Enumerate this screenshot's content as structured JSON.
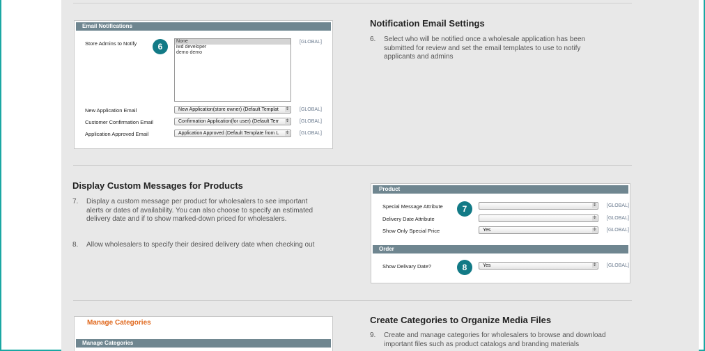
{
  "email_panel": {
    "header": "Email Notifications",
    "store_admins_label": "Store Admins to Notify",
    "admins_options": [
      "None",
      "iwd developer",
      "demo demo"
    ],
    "new_app_label": "New Application Email",
    "new_app_value": "New Application(store owner) (Default Templat",
    "customer_conf_label": "Customer Confirmation Email",
    "customer_conf_value": "Confirmation Application(for user) (Default Terr",
    "approved_label": "Application Approved Email",
    "approved_value": "Application Approved (Default Template from L",
    "scope": "[GLOBAL]",
    "badge": "6"
  },
  "notification_section": {
    "heading": "Notification Email Settings",
    "step_num": "6.",
    "step_text": "Select who will be notified once a wholesale application has been submitted for review and set the email templates to use to notify applicants and admins"
  },
  "custom_messages_section": {
    "heading": "Display Custom Messages for Products",
    "step7_num": "7.",
    "step7_text": "Display a custom message per product for wholesalers to see important alerts or dates of availability. You can also choose to specify an estimated delivery date and if to show marked-down priced for wholesalers.",
    "step8_num": "8.",
    "step8_text": "Allow wholesalers to specify their desired delivery date when checking out"
  },
  "product_panel": {
    "header": "Product",
    "special_msg_label": "Special Message Attribute",
    "special_msg_value": "",
    "delivery_date_label": "Delivery Date Attribute",
    "delivery_date_value": "",
    "special_price_label": "Show Only Special Price",
    "special_price_value": "Yes",
    "scope": "[GLOBAL]",
    "badge": "7"
  },
  "order_panel": {
    "header": "Order",
    "show_delivery_label": "Show Delivary Date?",
    "show_delivery_value": "Yes",
    "scope": "[GLOBAL]",
    "badge": "8"
  },
  "categories_panel": {
    "title": "Manage Categories",
    "header": "Manage Categories"
  },
  "categories_section": {
    "heading": "Create Categories to Organize Media Files",
    "step_num": "9.",
    "step_text": "Create and manage categories for wholesalers to browse and download important files such as product catalogs and branding materials"
  }
}
